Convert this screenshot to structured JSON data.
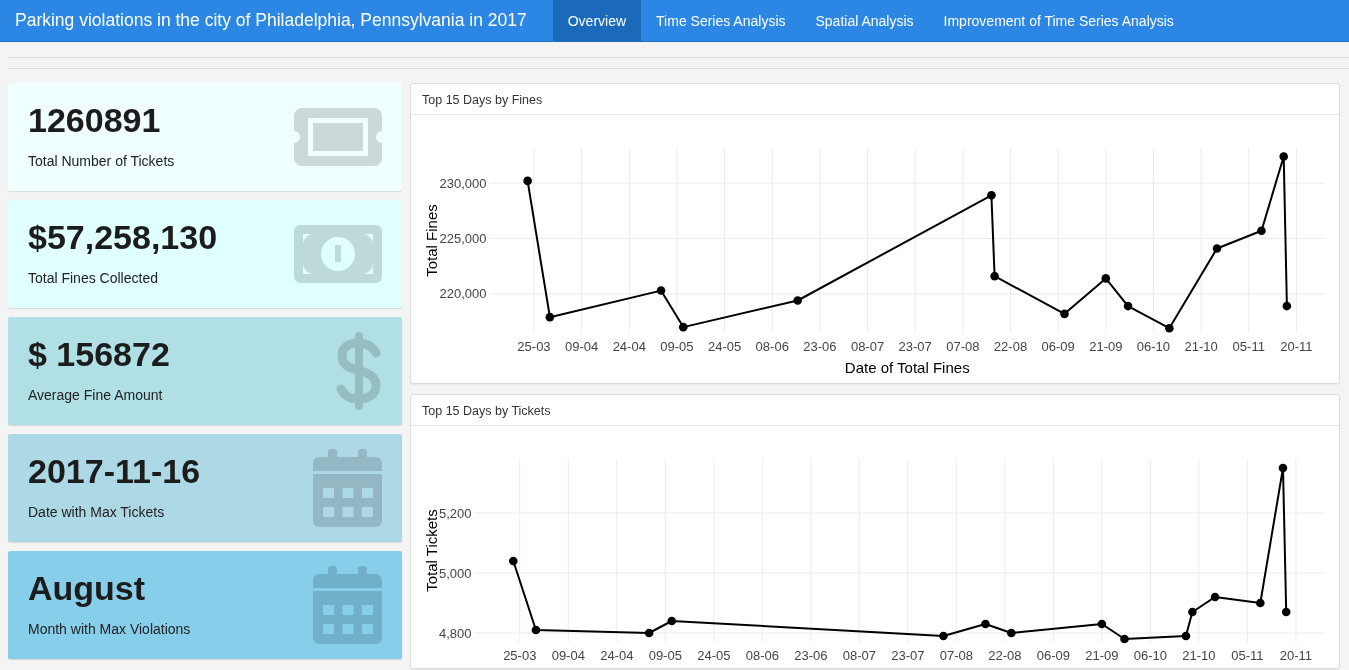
{
  "navbar": {
    "title": "Parking violations in the city of Philadelphia, Pennsylvania in 2017",
    "tabs": [
      {
        "label": "Overview",
        "selected": true
      },
      {
        "label": "Time Series Analysis",
        "selected": false
      },
      {
        "label": "Spatial Analysis",
        "selected": false
      },
      {
        "label": "Improvement of Time Series Analysis",
        "selected": false
      }
    ]
  },
  "value_boxes": [
    {
      "kind": "count",
      "value": "1260891",
      "label": "Total Number of Tickets",
      "color": "#f0ffff"
    },
    {
      "kind": "total",
      "value": "$57,258,130",
      "label": "Total Fines Collected",
      "color": "#e0ffff"
    },
    {
      "kind": "average",
      "value": "$ 156872",
      "label": "Average Fine Amount",
      "color": "#b0e0e6"
    },
    {
      "kind": "date",
      "value": "2017-11-16",
      "label": "Date with Max Tickets",
      "color": "#add8e6"
    },
    {
      "kind": "month",
      "value": "August",
      "label": "Month with Max Violations",
      "color": "#87ceeb"
    }
  ],
  "charts": [
    {
      "chart_data": {
        "type": "line",
        "title": "Top 15 Days by Fines",
        "xlabel": "Date of Total Fines",
        "ylabel": "Total Fines",
        "grid": true,
        "x": [
          "2017-03-23",
          "2017-03-30",
          "2017-05-04",
          "2017-05-11",
          "2017-06-16",
          "2017-08-16",
          "2017-08-17",
          "2017-09-08",
          "2017-09-21",
          "2017-09-28",
          "2017-10-11",
          "2017-10-26",
          "2017-11-09",
          "2017-11-16",
          "2017-11-17"
        ],
        "series": [
          {
            "color": "#000000",
            "marker": true,
            "values": [
              230200,
              217900,
              220300,
              217000,
              219400,
              228900,
              221600,
              218200,
              221400,
              218900,
              216900,
              224100,
              225700,
              232400,
              218900
            ]
          }
        ],
        "xlim": [
          "2017-03-11",
          "2017-11-29"
        ],
        "ylim": [
          216470,
          233170
        ],
        "xticks": [
          {
            "value": "2017-03-25",
            "label": "25-03"
          },
          {
            "value": "2017-04-09",
            "label": "09-04"
          },
          {
            "value": "2017-04-24",
            "label": "24-04"
          },
          {
            "value": "2017-05-09",
            "label": "09-05"
          },
          {
            "value": "2017-05-24",
            "label": "24-05"
          },
          {
            "value": "2017-06-08",
            "label": "08-06"
          },
          {
            "value": "2017-06-23",
            "label": "23-06"
          },
          {
            "value": "2017-07-08",
            "label": "08-07"
          },
          {
            "value": "2017-07-23",
            "label": "23-07"
          },
          {
            "value": "2017-08-07",
            "label": "07-08"
          },
          {
            "value": "2017-08-22",
            "label": "22-08"
          },
          {
            "value": "2017-09-06",
            "label": "06-09"
          },
          {
            "value": "2017-09-21",
            "label": "21-09"
          },
          {
            "value": "2017-10-06",
            "label": "06-10"
          },
          {
            "value": "2017-10-21",
            "label": "21-10"
          },
          {
            "value": "2017-11-05",
            "label": "05-11"
          },
          {
            "value": "2017-11-20",
            "label": "20-11"
          }
        ],
        "yticks": [
          {
            "value": 220000,
            "label": "220,000"
          },
          {
            "value": 225000,
            "label": "225,000"
          },
          {
            "value": 230000,
            "label": "230,000"
          }
        ]
      }
    },
    {
      "chart_data": {
        "type": "line",
        "title": "Top 15 Days by Tickets",
        "ylabel": "Total Tickets",
        "grid": true,
        "x": [
          "2017-03-23",
          "2017-03-30",
          "2017-05-04",
          "2017-05-11",
          "2017-08-03",
          "2017-08-16",
          "2017-08-24",
          "2017-09-21",
          "2017-09-28",
          "2017-10-17",
          "2017-10-19",
          "2017-10-26",
          "2017-11-09",
          "2017-11-16",
          "2017-11-17"
        ],
        "series": [
          {
            "color": "#000000",
            "marker": true,
            "values": [
              5040,
              4810,
              4800,
              4840,
              4790,
              4830,
              4800,
              4830,
              4780,
              4790,
              4870,
              4920,
              4900,
              5350,
              4870
            ]
          }
        ],
        "xlim": [
          "2017-03-11",
          "2017-11-29"
        ],
        "ylim": [
          4770,
          5380
        ],
        "xticks": [
          {
            "value": "2017-03-25",
            "label": "25-03"
          },
          {
            "value": "2017-04-09",
            "label": "09-04"
          },
          {
            "value": "2017-04-24",
            "label": "24-04"
          },
          {
            "value": "2017-05-09",
            "label": "09-05"
          },
          {
            "value": "2017-05-24",
            "label": "24-05"
          },
          {
            "value": "2017-06-08",
            "label": "08-06"
          },
          {
            "value": "2017-06-23",
            "label": "23-06"
          },
          {
            "value": "2017-07-08",
            "label": "08-07"
          },
          {
            "value": "2017-07-23",
            "label": "23-07"
          },
          {
            "value": "2017-08-07",
            "label": "07-08"
          },
          {
            "value": "2017-08-22",
            "label": "22-08"
          },
          {
            "value": "2017-09-06",
            "label": "06-09"
          },
          {
            "value": "2017-09-21",
            "label": "21-09"
          },
          {
            "value": "2017-10-06",
            "label": "06-10"
          },
          {
            "value": "2017-10-21",
            "label": "21-10"
          },
          {
            "value": "2017-11-05",
            "label": "05-11"
          },
          {
            "value": "2017-11-20",
            "label": "20-11"
          }
        ],
        "yticks": [
          {
            "value": 4800,
            "label": "4,800"
          },
          {
            "value": 5000,
            "label": "5,000"
          },
          {
            "value": 5200,
            "label": "5,200"
          }
        ]
      }
    }
  ]
}
